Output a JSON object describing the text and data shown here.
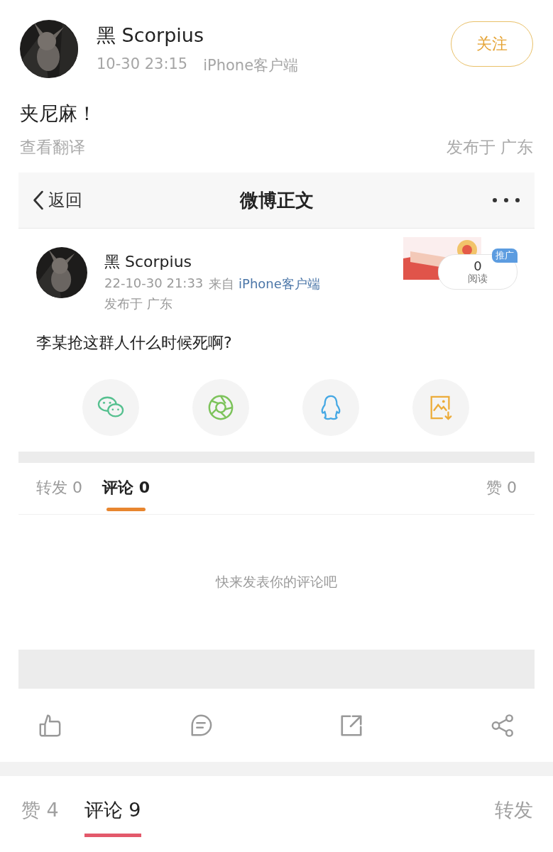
{
  "post": {
    "author": "黑 Scorpius",
    "time": "10-30 23:15",
    "source": "iPhone客户端",
    "follow_button": "关注",
    "text": "夹尼麻！",
    "translate_link": "查看翻译",
    "location": "发布于 广东"
  },
  "embedded_screenshot": {
    "nav": {
      "back": "返回",
      "title": "微博正文"
    },
    "post": {
      "author": "黑 Scorpius",
      "time": "22-10-30 21:33",
      "source_prefix": "来自",
      "source": "iPhone客户端",
      "location": "发布于 广东",
      "text": "李某抢这群人什么时候死啊?",
      "read_count": "0",
      "read_label": "阅读",
      "promo_badge": "推广"
    },
    "tabs": [
      {
        "label": "转发",
        "count": "0",
        "selected": false
      },
      {
        "label": "评论",
        "count": "0",
        "selected": true
      },
      {
        "label": "赞",
        "count": "0",
        "selected": false
      }
    ],
    "empty_message": "快来发表你的评论吧"
  },
  "bottom_tabs": [
    {
      "label": "赞",
      "count": "4",
      "selected": false
    },
    {
      "label": "评论",
      "count": "9",
      "selected": true
    },
    {
      "label": "转发",
      "selected": false
    }
  ]
}
